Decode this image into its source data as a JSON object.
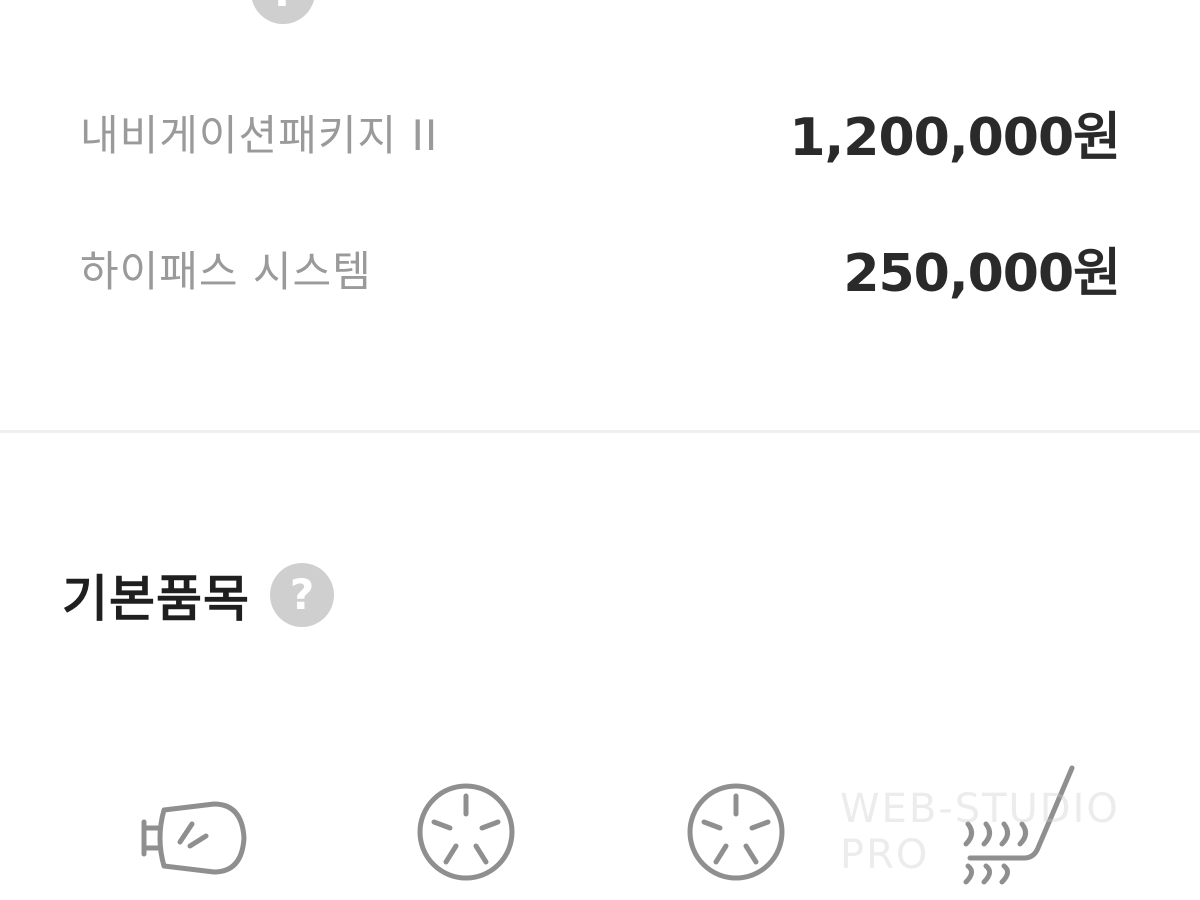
{
  "top_section": {
    "help_symbol": "?"
  },
  "options": [
    {
      "name": "내비게이션패키지 II",
      "price": "1,200,000원"
    },
    {
      "name": "하이패스 시스템",
      "price": "250,000원"
    }
  ],
  "basic_items": {
    "title": "기본품목",
    "help_symbol": "?",
    "icons": [
      "headlamp-icon",
      "wheel-icon",
      "wheel-icon",
      "heated-seat-icon"
    ]
  },
  "watermark": "WEB-STUDIO PRO"
}
